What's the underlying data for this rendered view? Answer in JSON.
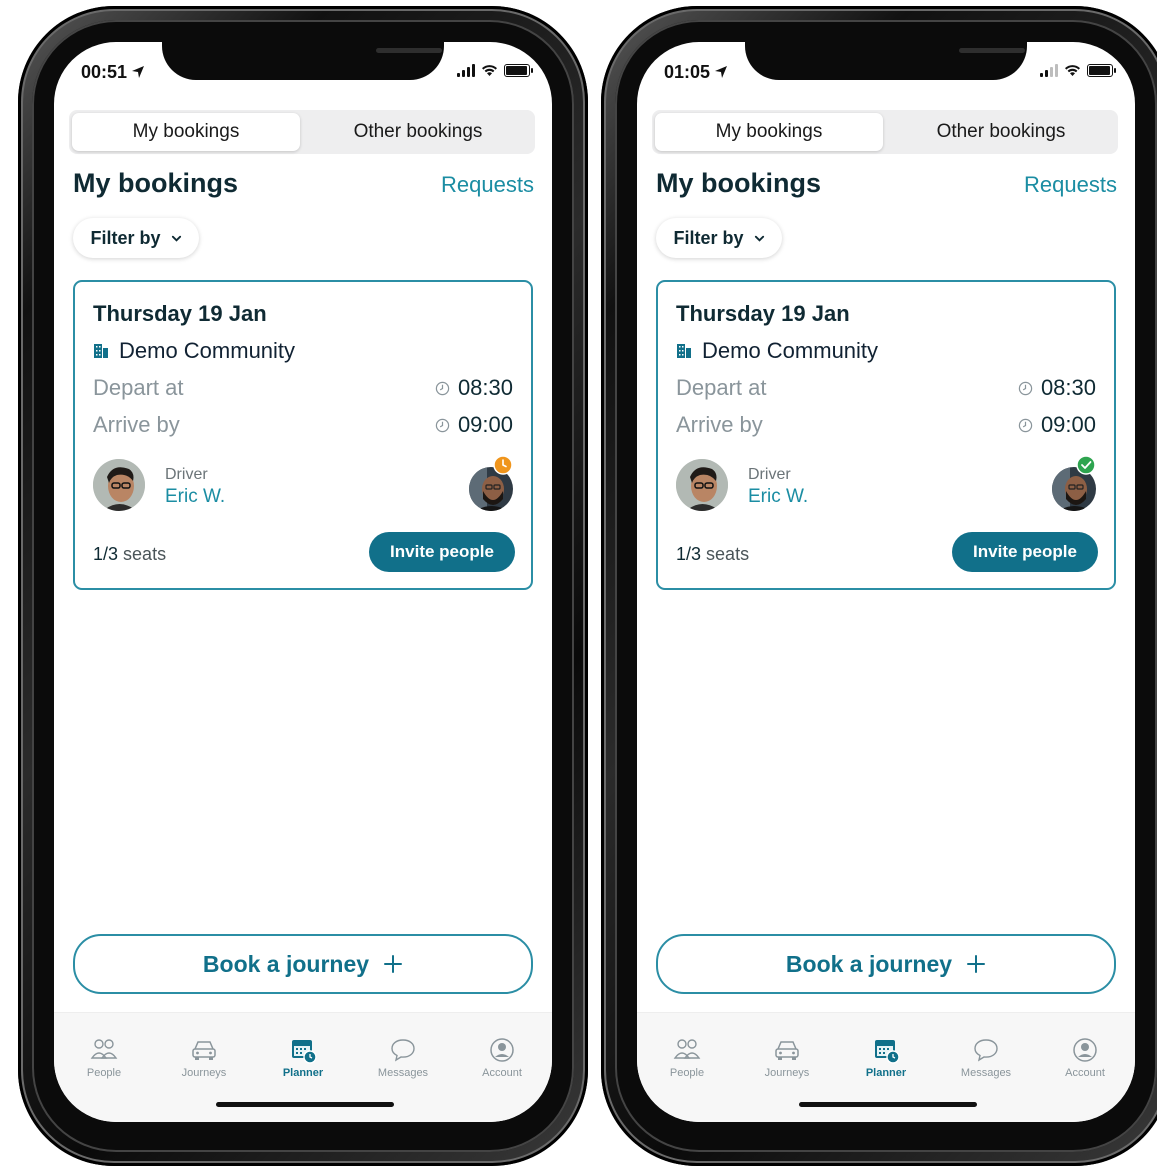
{
  "phones": [
    {
      "status": {
        "time": "00:51"
      },
      "segmented": {
        "active": "My bookings",
        "inactive": "Other bookings"
      },
      "header": {
        "title": "My bookings",
        "requests": "Requests"
      },
      "filter": {
        "label": "Filter by"
      },
      "booking": {
        "date": "Thursday 19 Jan",
        "community": "Demo Community",
        "depart_label": "Depart at",
        "depart_time": "08:30",
        "arrive_label": "Arrive by",
        "arrive_time": "09:00",
        "driver_label": "Driver",
        "driver_name": "Eric W.",
        "seats": "1/3",
        "seats_suffix": "seats",
        "invite_label": "Invite people",
        "passenger_status": "pending",
        "passenger_status_color": "#f0951c"
      },
      "book_button": {
        "label": "Book a journey"
      },
      "tabs": [
        "People",
        "Journeys",
        "Planner",
        "Messages",
        "Account"
      ],
      "active_tab": "Planner"
    },
    {
      "status": {
        "time": "01:05"
      },
      "segmented": {
        "active": "My bookings",
        "inactive": "Other bookings"
      },
      "header": {
        "title": "My bookings",
        "requests": "Requests"
      },
      "filter": {
        "label": "Filter by"
      },
      "booking": {
        "date": "Thursday 19 Jan",
        "community": "Demo Community",
        "depart_label": "Depart at",
        "depart_time": "08:30",
        "arrive_label": "Arrive by",
        "arrive_time": "09:00",
        "driver_label": "Driver",
        "driver_name": "Eric W.",
        "seats": "1/3",
        "seats_suffix": "seats",
        "invite_label": "Invite people",
        "passenger_status": "confirmed",
        "passenger_status_color": "#2ea44f"
      },
      "book_button": {
        "label": "Book a journey"
      },
      "tabs": [
        "People",
        "Journeys",
        "Planner",
        "Messages",
        "Account"
      ],
      "active_tab": "Planner"
    }
  ],
  "colors": {
    "accent": "#1b8da3",
    "primary_dark": "#11708a",
    "title": "#0f2a33"
  }
}
